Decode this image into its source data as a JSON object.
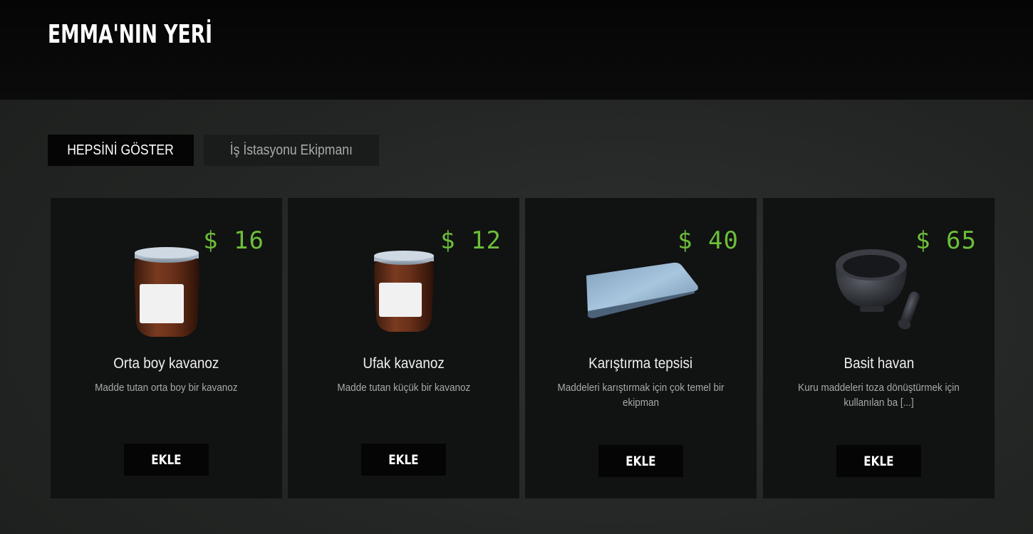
{
  "header": {
    "title": "EMMA'NIN YERİ"
  },
  "tabs": [
    {
      "label": "HEPSİNİ GÖSTER"
    },
    {
      "label": "İş İstasyonu Ekipmanı"
    }
  ],
  "colors": {
    "price": "#6cbe3a",
    "card_bg": "#111212",
    "button_bg": "#050505"
  },
  "items": [
    {
      "price": "$ 16",
      "name": "Orta boy kavanoz",
      "description": "Madde tutan orta boy bir kavanoz",
      "button": "EKLE",
      "icon": "medium-jar-icon"
    },
    {
      "price": "$ 12",
      "name": "Ufak kavanoz",
      "description": "Madde tutan küçük bir kavanoz",
      "button": "EKLE",
      "icon": "small-jar-icon"
    },
    {
      "price": "$ 40",
      "name": "Karıştırma tepsisi",
      "description": "Maddeleri karıştırmak için çok temel bir ekipman",
      "button": "EKLE",
      "icon": "mixing-tray-icon"
    },
    {
      "price": "$ 65",
      "name": "Basit havan",
      "description": "Kuru maddeleri toza dönüştürmek için kullanılan ba [...]",
      "button": "EKLE",
      "icon": "mortar-pestle-icon"
    }
  ]
}
